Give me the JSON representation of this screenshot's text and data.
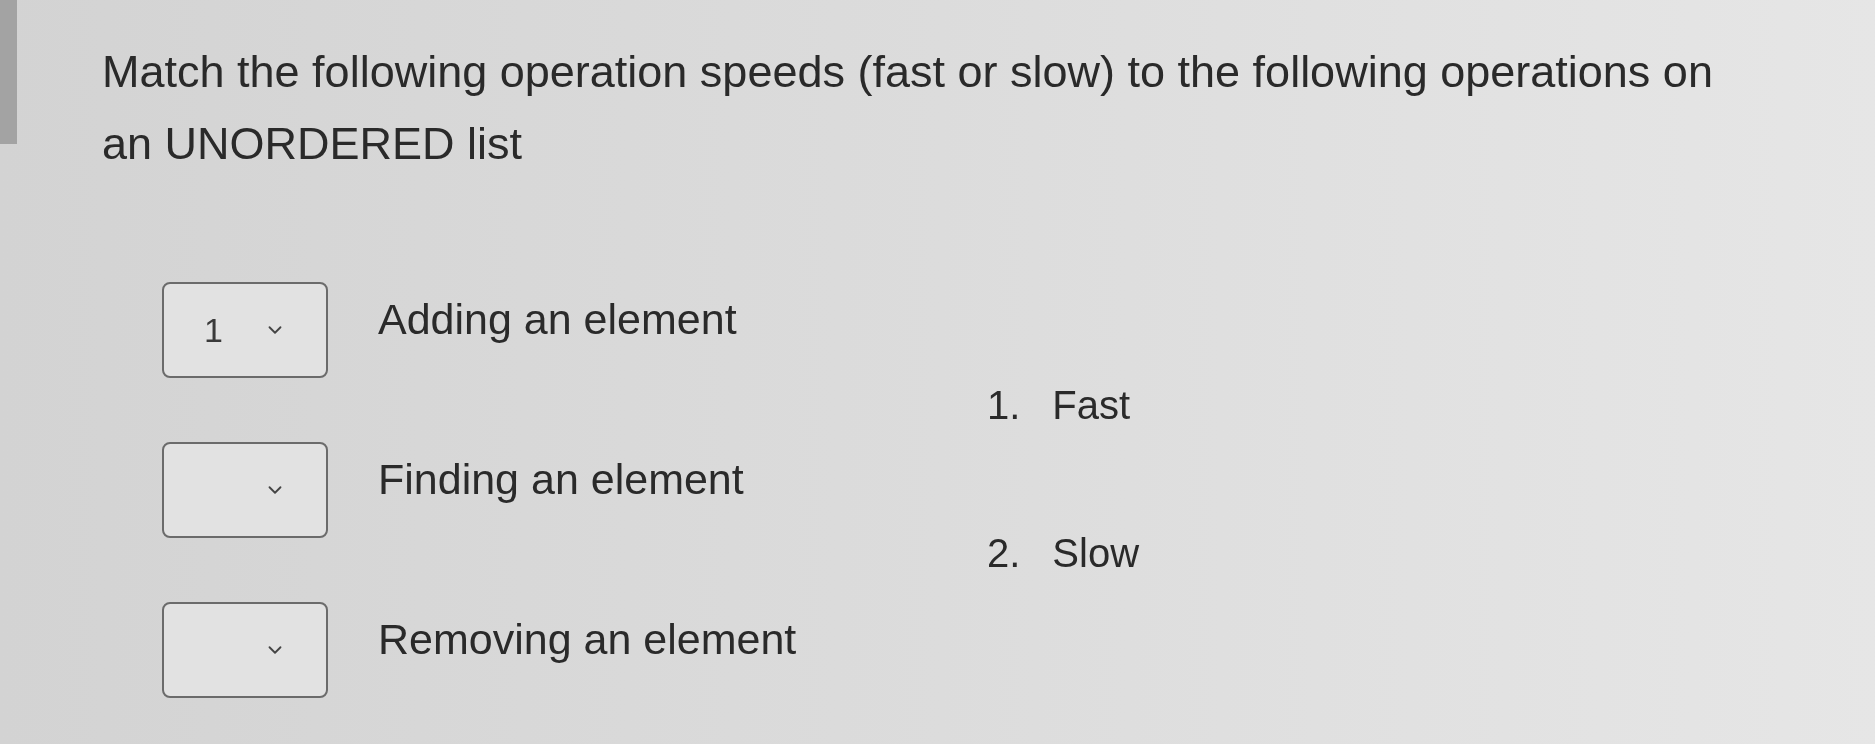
{
  "question": {
    "text": "Match the following operation speeds (fast or slow) to the following operations on an UNORDERED list"
  },
  "matches": [
    {
      "value": "1",
      "label": "Adding an element"
    },
    {
      "label": "Finding an element"
    },
    {
      "label": "Removing an element"
    }
  ],
  "answers": [
    {
      "number": "1.",
      "text": "Fast"
    },
    {
      "number": "2.",
      "text": "Slow"
    }
  ]
}
